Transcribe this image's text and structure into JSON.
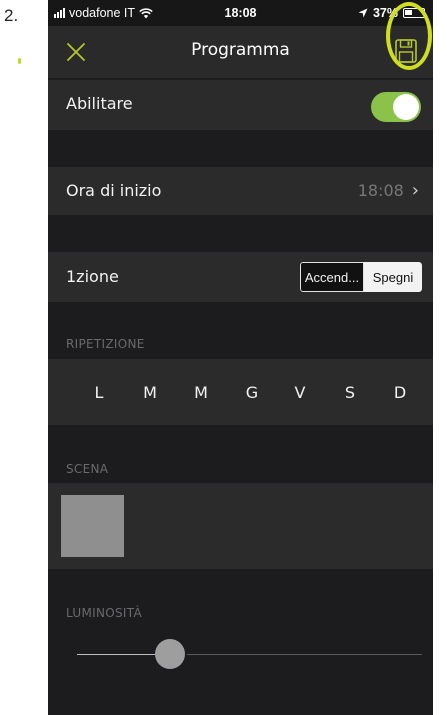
{
  "step_number": "2.",
  "status_bar": {
    "carrier": "vodafone IT",
    "time": "18:08",
    "battery": "37%"
  },
  "nav": {
    "title": "Programma",
    "close_icon": "close-icon",
    "save_icon": "floppy-disk-icon"
  },
  "enable": {
    "label": "Abilitare",
    "on": true
  },
  "start_time": {
    "label": "Ora di inizio",
    "value": "18:08"
  },
  "action": {
    "label": "1zione",
    "options": [
      "Accend...",
      "Spegni"
    ],
    "selected": "Spegni"
  },
  "repeat": {
    "header": "RIPETIZIONE",
    "days": [
      "L",
      "M",
      "M",
      "G",
      "V",
      "S",
      "D"
    ]
  },
  "scene": {
    "header": "SCENA"
  },
  "brightness": {
    "header": "LUMINOSITÀ",
    "level": 0.29
  },
  "colors": {
    "background": "#1c1c1e",
    "row": "#2b2b2b",
    "toggle_on": "#8bc34a",
    "accent": "#cfde1f"
  }
}
